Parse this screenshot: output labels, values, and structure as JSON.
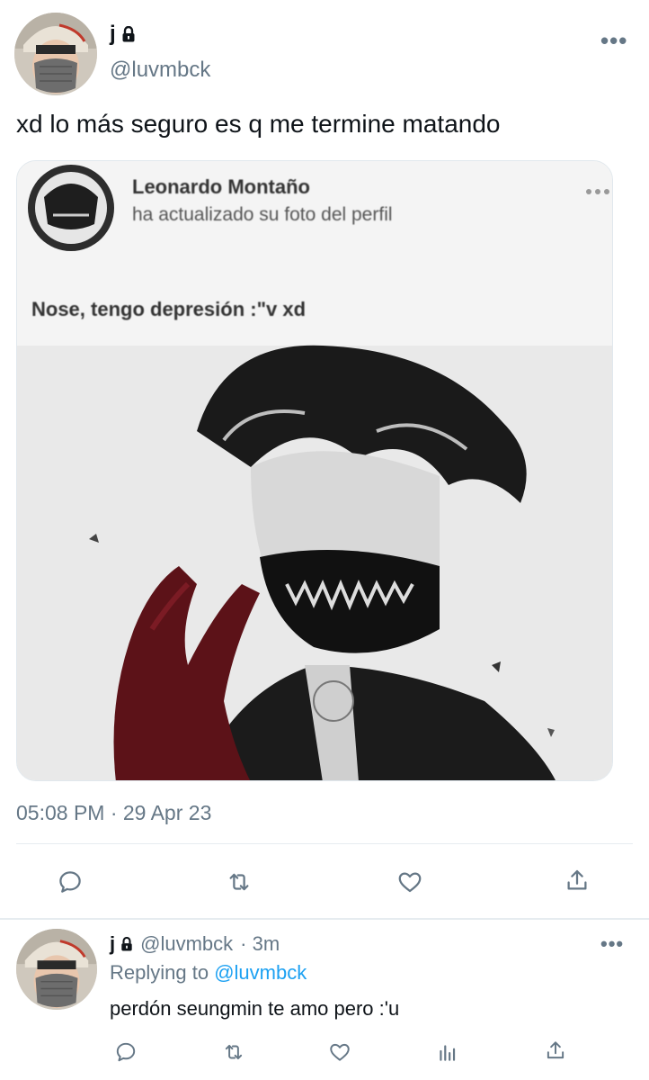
{
  "tweet": {
    "display_name": "j",
    "handle": "@luvmbck",
    "text": "xd lo más seguro es q me termine matando",
    "timestamp": "05:08 PM · 29 Apr 23",
    "more_label": "•••",
    "media": {
      "poster_name": "Leonardo Montaño",
      "action": "ha actualizado su foto del perfil",
      "caption": "Nose, tengo depresión :\"v xd"
    }
  },
  "reply": {
    "display_name": "j",
    "handle": "@luvmbck",
    "age": "· 3m",
    "replying_prefix": "Replying to",
    "replying_handle": "@luvmbck",
    "text": "perdón seungmin te amo pero :'u",
    "more_label": "•••"
  },
  "icons": [
    "lock-icon",
    "reply-icon",
    "retweet-icon",
    "like-icon",
    "share-icon",
    "analytics-icon"
  ],
  "colors": {
    "link": "#1da1f2",
    "muted": "#657786",
    "text": "#0f1419"
  }
}
